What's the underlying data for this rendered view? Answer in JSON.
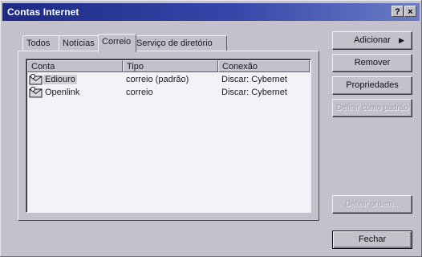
{
  "window": {
    "title": "Contas Internet"
  },
  "titlebar_buttons": {
    "help": "?",
    "close": "×"
  },
  "tabs": [
    {
      "label": "Todos",
      "active": false
    },
    {
      "label": "Notícias",
      "active": false
    },
    {
      "label": "Correio",
      "active": true
    },
    {
      "label": "Serviço de diretório",
      "active": false
    }
  ],
  "accounts_list": {
    "columns": [
      "Conta",
      "Tipo",
      "Conexão"
    ],
    "rows": [
      {
        "icon": "mail-account-icon",
        "conta": "Ediouro",
        "tipo": "correio (padrão)",
        "conexao": "Discar: Cybernet",
        "selected": true
      },
      {
        "icon": "mail-account-icon",
        "conta": "Openlink",
        "tipo": "correio",
        "conexao": "Discar: Cybernet",
        "selected": false
      }
    ]
  },
  "buttons": {
    "adicionar": "Adicionar",
    "remover": "Remover",
    "propriedades": "Propriedades",
    "definir_padrao": "Definir como padrão",
    "definir_ordem": "Definir ordem...",
    "fechar": "Fechar"
  },
  "colors": {
    "titlebar_start": "#1d2a86",
    "titlebar_end": "#6a7cc6",
    "face": "#c3c2cc"
  }
}
